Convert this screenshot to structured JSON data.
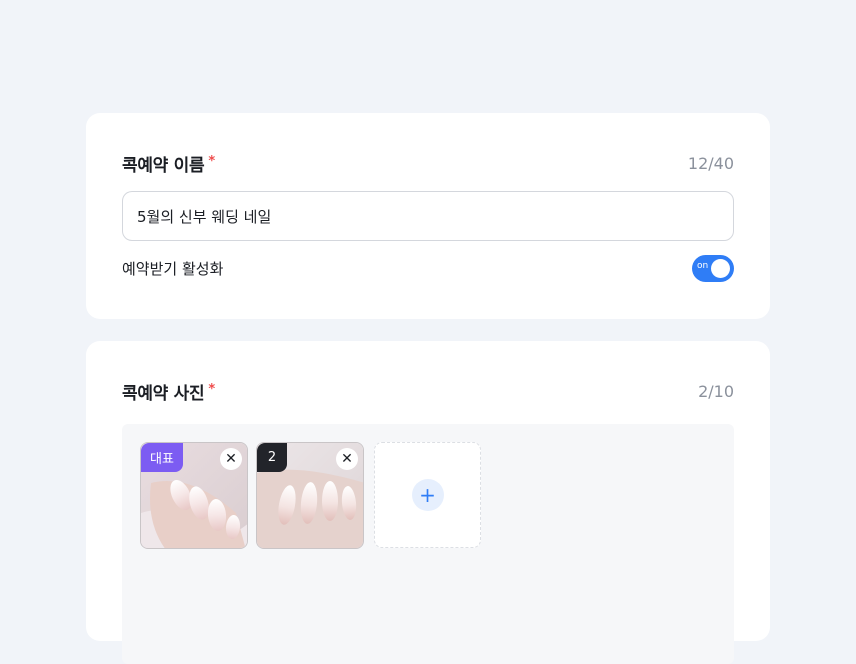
{
  "name_section": {
    "title": "콕예약 이름",
    "required_mark": "*",
    "counter": "12/40",
    "input_value": "5월의 신부 웨딩 네일",
    "toggle_label": "예약받기 활성화",
    "toggle_text": "on",
    "toggle_on": true
  },
  "photo_section": {
    "title": "콕예약 사진",
    "required_mark": "*",
    "counter": "2/10",
    "photos": [
      {
        "badge": "대표",
        "close_icon": "close-icon"
      },
      {
        "badge": "2",
        "close_icon": "close-icon"
      }
    ],
    "add_icon": "plus-icon",
    "add_symbol": "+",
    "close_symbol": "✕"
  },
  "colors": {
    "background": "#f1f4f9",
    "accent": "#2f7df6",
    "required": "#ef4c4c",
    "badge_main": "#7c5cf2",
    "badge_num": "#22242a"
  }
}
